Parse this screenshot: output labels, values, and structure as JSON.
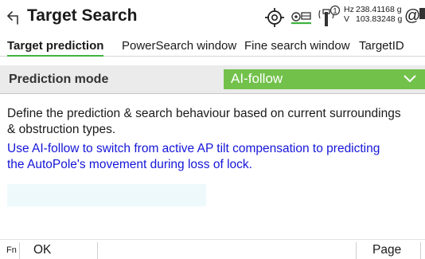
{
  "header": {
    "title": "Target Search",
    "hz_label": "Hz",
    "hz_value": "238.41168 g",
    "v_label": "V",
    "v_value": "103.83248 g",
    "autopole_badge": "1",
    "icons": [
      "back-arrow-icon",
      "target-icon",
      "prism-icon",
      "autopole-icon",
      "at-icon",
      "battery-icon"
    ]
  },
  "tabs": [
    {
      "label": "Target prediction",
      "active": true
    },
    {
      "label": "PowerSearch window",
      "active": false
    },
    {
      "label": "Fine search window",
      "active": false
    },
    {
      "label": "TargetID",
      "active": false
    }
  ],
  "form": {
    "prediction_mode_label": "Prediction mode",
    "prediction_mode_value": "AI-follow"
  },
  "content": {
    "description_line1": "Define the prediction & search behaviour based on current surroundings",
    "description_line2": "& obstruction types.",
    "hint_line1": "Use AI-follow to switch from active AP tilt compensation to predicting",
    "hint_line2": "the AutoPole's movement during loss of lock."
  },
  "softkeys": {
    "fn": "Fn",
    "ok": "OK",
    "page": "Page"
  },
  "colors": {
    "accent_green": "#72c14b",
    "tab_underline": "#3fb33f",
    "hint_blue": "#1515d8",
    "row_background": "#ebebeb"
  }
}
